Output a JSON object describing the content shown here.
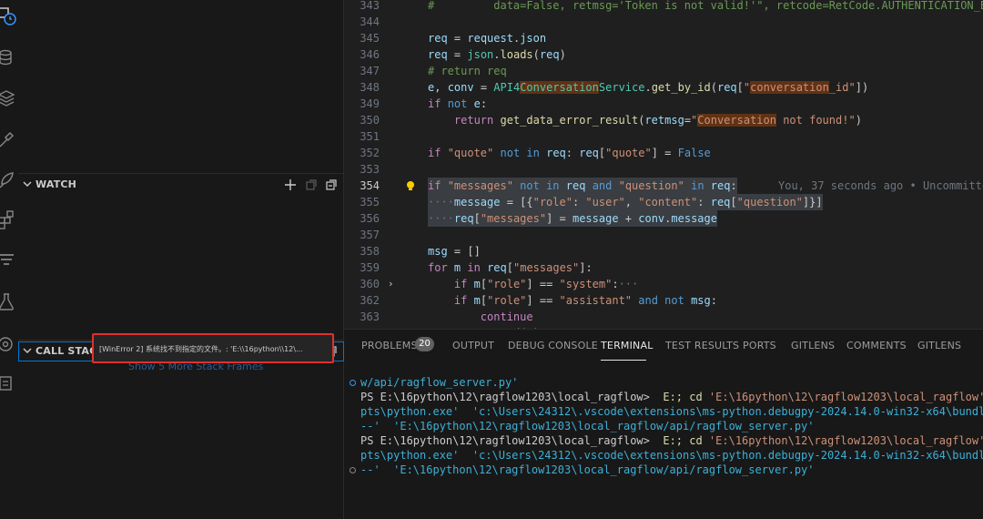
{
  "sidebar": {
    "watch_title": "WATCH",
    "call_stack_title": "CALL STACK",
    "call_stack_tooltip": "[WinError 2] 系统找不到指定的文件。: 'E:\\\\16python\\\\12\\...",
    "show_more": "Show 5 More Stack Frames",
    "icons": [
      "clock-icon",
      "database-icon",
      "layers-icon",
      "brush-icon",
      "rocket-icon",
      "extensions-icon",
      "filter-icon",
      "flask-icon",
      "remote-icon",
      "document-icon"
    ]
  },
  "editor": {
    "lines": [
      {
        "n": "343",
        "segs": [
          [
            "t-com",
            "#         data=False, retmsg='Token is not valid!'\", retcode=RetCode.AUTHENTICATION_E"
          ]
        ]
      },
      {
        "n": "344",
        "segs": []
      },
      {
        "n": "345",
        "segs": [
          [
            "t-var",
            "req"
          ],
          [
            "t-pl",
            " = "
          ],
          [
            "t-var",
            "request"
          ],
          [
            "t-pl",
            "."
          ],
          [
            "t-var",
            "json"
          ]
        ]
      },
      {
        "n": "346",
        "segs": [
          [
            "t-var",
            "req"
          ],
          [
            "t-pl",
            " = "
          ],
          [
            "t-cls",
            "json"
          ],
          [
            "t-pl",
            "."
          ],
          [
            "t-fn",
            "loads"
          ],
          [
            "t-pl",
            "("
          ],
          [
            "t-var",
            "req"
          ],
          [
            "t-pl",
            ")"
          ]
        ]
      },
      {
        "n": "347",
        "segs": [
          [
            "t-com",
            "# return req"
          ]
        ]
      },
      {
        "n": "348",
        "segs": [
          [
            "t-var",
            "e"
          ],
          [
            "t-pl",
            ", "
          ],
          [
            "t-var",
            "conv"
          ],
          [
            "t-pl",
            " = "
          ],
          [
            "t-cls",
            "API4"
          ],
          [
            "t-cls t-match",
            "Conversation"
          ],
          [
            "t-cls",
            "Service"
          ],
          [
            "t-pl",
            "."
          ],
          [
            "t-fn",
            "get_by_id"
          ],
          [
            "t-pl",
            "("
          ],
          [
            "t-var",
            "req"
          ],
          [
            "t-pl",
            "["
          ],
          [
            "t-str",
            "\""
          ],
          [
            "t-str t-match",
            "conversation"
          ],
          [
            "t-str",
            "_id\""
          ],
          [
            "t-pl",
            "])"
          ]
        ]
      },
      {
        "n": "349",
        "segs": [
          [
            "t-ctl",
            "if"
          ],
          [
            "t-pl",
            " "
          ],
          [
            "t-kw",
            "not"
          ],
          [
            "t-pl",
            " "
          ],
          [
            "t-var",
            "e"
          ],
          [
            "t-pl",
            ":"
          ]
        ]
      },
      {
        "n": "350",
        "segs": [
          [
            "t-pl",
            "    "
          ],
          [
            "t-ctl",
            "return"
          ],
          [
            "t-pl",
            " "
          ],
          [
            "t-fn",
            "get_data_error_result"
          ],
          [
            "t-pl",
            "("
          ],
          [
            "t-var",
            "retmsg"
          ],
          [
            "t-pl",
            "="
          ],
          [
            "t-str",
            "\""
          ],
          [
            "t-str t-match",
            "Conversation"
          ],
          [
            "t-str",
            " not found!\""
          ],
          [
            "t-pl",
            ")"
          ]
        ]
      },
      {
        "n": "351",
        "segs": []
      },
      {
        "n": "352",
        "segs": [
          [
            "t-ctl",
            "if"
          ],
          [
            "t-pl",
            " "
          ],
          [
            "t-str",
            "\"quote\""
          ],
          [
            "t-pl",
            " "
          ],
          [
            "t-kw",
            "not in"
          ],
          [
            "t-pl",
            " "
          ],
          [
            "t-var",
            "req"
          ],
          [
            "t-pl",
            ": "
          ],
          [
            "t-var",
            "req"
          ],
          [
            "t-pl",
            "["
          ],
          [
            "t-str",
            "\"quote\""
          ],
          [
            "t-pl",
            "] = "
          ],
          [
            "t-kw",
            "False"
          ]
        ]
      },
      {
        "n": "353",
        "segs": []
      },
      {
        "n": "354",
        "active": true,
        "bulb": true,
        "hl": true,
        "blame": "You, 37 seconds ago • Uncommitte",
        "segs": [
          [
            "t-ctl",
            "if"
          ],
          [
            "t-pl",
            " "
          ],
          [
            "t-str",
            "\"messages\""
          ],
          [
            "t-pl",
            " "
          ],
          [
            "t-kw",
            "not in"
          ],
          [
            "t-pl",
            " "
          ],
          [
            "t-var",
            "req"
          ],
          [
            "t-pl",
            " "
          ],
          [
            "t-kw",
            "and"
          ],
          [
            "t-pl",
            " "
          ],
          [
            "t-str",
            "\"question\""
          ],
          [
            "t-pl",
            " "
          ],
          [
            "t-kw",
            "in"
          ],
          [
            "t-pl",
            " "
          ],
          [
            "t-var",
            "req"
          ],
          [
            "t-pl",
            ":"
          ]
        ]
      },
      {
        "n": "355",
        "hl": true,
        "segs": [
          [
            "t-dim",
            "····"
          ],
          [
            "t-var",
            "message"
          ],
          [
            "t-pl",
            " = [{"
          ],
          [
            "t-str",
            "\"role\""
          ],
          [
            "t-pl",
            ": "
          ],
          [
            "t-str",
            "\"user\""
          ],
          [
            "t-pl",
            ", "
          ],
          [
            "t-str",
            "\"content\""
          ],
          [
            "t-pl",
            ": "
          ],
          [
            "t-var",
            "req"
          ],
          [
            "t-pl",
            "["
          ],
          [
            "t-str",
            "\"question\""
          ],
          [
            "t-pl",
            "]}]"
          ]
        ]
      },
      {
        "n": "356",
        "hl": true,
        "segs": [
          [
            "t-dim",
            "····"
          ],
          [
            "t-var",
            "req"
          ],
          [
            "t-pl",
            "["
          ],
          [
            "t-str",
            "\"messages\""
          ],
          [
            "t-pl",
            "] = "
          ],
          [
            "t-var",
            "message"
          ],
          [
            "t-pl",
            " + "
          ],
          [
            "t-var",
            "conv"
          ],
          [
            "t-pl",
            "."
          ],
          [
            "t-var",
            "message"
          ]
        ]
      },
      {
        "n": "357",
        "segs": []
      },
      {
        "n": "358",
        "segs": [
          [
            "t-var",
            "msg"
          ],
          [
            "t-pl",
            " = []"
          ]
        ]
      },
      {
        "n": "359",
        "segs": [
          [
            "t-ctl",
            "for"
          ],
          [
            "t-pl",
            " "
          ],
          [
            "t-var",
            "m"
          ],
          [
            "t-pl",
            " "
          ],
          [
            "t-ctl",
            "in"
          ],
          [
            "t-pl",
            " "
          ],
          [
            "t-var",
            "req"
          ],
          [
            "t-pl",
            "["
          ],
          [
            "t-str",
            "\"messages\""
          ],
          [
            "t-pl",
            "]:"
          ]
        ]
      },
      {
        "n": "360",
        "fold": true,
        "segs": [
          [
            "t-pl",
            "    "
          ],
          [
            "t-ctl",
            "if"
          ],
          [
            "t-pl",
            " "
          ],
          [
            "t-var",
            "m"
          ],
          [
            "t-pl",
            "["
          ],
          [
            "t-str",
            "\"role\""
          ],
          [
            "t-pl",
            "] == "
          ],
          [
            "t-str",
            "\"system\""
          ],
          [
            "t-pl",
            ":"
          ],
          [
            "t-dim",
            "···"
          ]
        ]
      },
      {
        "n": "362",
        "segs": [
          [
            "t-pl",
            "    "
          ],
          [
            "t-ctl",
            "if"
          ],
          [
            "t-pl",
            " "
          ],
          [
            "t-var",
            "m"
          ],
          [
            "t-pl",
            "["
          ],
          [
            "t-str",
            "\"role\""
          ],
          [
            "t-pl",
            "] == "
          ],
          [
            "t-str",
            "\"assistant\""
          ],
          [
            "t-pl",
            " "
          ],
          [
            "t-kw",
            "and not"
          ],
          [
            "t-pl",
            " "
          ],
          [
            "t-var",
            "msg"
          ],
          [
            "t-pl",
            ":"
          ]
        ]
      },
      {
        "n": "363",
        "segs": [
          [
            "t-pl",
            "        "
          ],
          [
            "t-ctl",
            "continue"
          ]
        ]
      },
      {
        "n": "364",
        "segs": [
          [
            "t-pl",
            "    "
          ],
          [
            "t-var",
            "msg"
          ],
          [
            "t-pl",
            "."
          ],
          [
            "t-fn",
            "append"
          ],
          [
            "t-pl",
            "("
          ],
          [
            "t-var",
            "m"
          ],
          [
            "t-pl",
            ")"
          ]
        ]
      }
    ]
  },
  "panel": {
    "tabs": [
      "PROBLEMS",
      "OUTPUT",
      "DEBUG CONSOLE",
      "TERMINAL",
      "TEST RESULTS",
      "PORTS",
      "GITLENS",
      "COMMENTS",
      "GITLENS"
    ],
    "active_tab": "TERMINAL",
    "problems_count": "20",
    "terminal_lines": [
      {
        "dot": "#3794ff",
        "segs": [
          [
            "t-cont",
            "w/api/ragflow_server.py'"
          ]
        ]
      },
      {
        "dot": null,
        "segs": [
          [
            "t-prompt",
            "PS E:\\16python\\12\\ragflow1203\\local_ragflow>  "
          ],
          [
            "t-cmd",
            "E:; cd "
          ],
          [
            "t-tstr",
            "'E:\\16python\\12\\ragflow1203\\local_ragflow'"
          ],
          [
            "t-prompt",
            "; & '"
          ]
        ]
      },
      {
        "dot": null,
        "segs": [
          [
            "t-cont",
            "pts\\python.exe'  'c:\\Users\\24312\\.vscode\\extensions\\ms-python.debugpy-2024.14.0-win32-x64\\bundled\\lib"
          ]
        ]
      },
      {
        "dot": null,
        "segs": [
          [
            "t-cont",
            "--'  'E:\\16python\\12\\ragflow1203\\local_ragflow/api/ragflow_server.py'"
          ]
        ]
      },
      {
        "dot": null,
        "segs": [
          [
            "t-prompt",
            "PS E:\\16python\\12\\ragflow1203\\local_ragflow>  "
          ],
          [
            "t-cmd",
            "E:; cd "
          ],
          [
            "t-tstr",
            "'E:\\16python\\12\\ragflow1203\\local_ragflow'"
          ],
          [
            "t-prompt",
            "; & '"
          ]
        ]
      },
      {
        "dot": null,
        "segs": [
          [
            "t-cont",
            "pts\\python.exe'  'c:\\Users\\24312\\.vscode\\extensions\\ms-python.debugpy-2024.14.0-win32-x64\\bundled\\lib"
          ]
        ]
      },
      {
        "dot": "ring",
        "segs": [
          [
            "t-cont",
            "--'  'E:\\16python\\12\\ragflow1203\\local_ragflow/api/ragflow_server.py'"
          ]
        ]
      }
    ]
  }
}
